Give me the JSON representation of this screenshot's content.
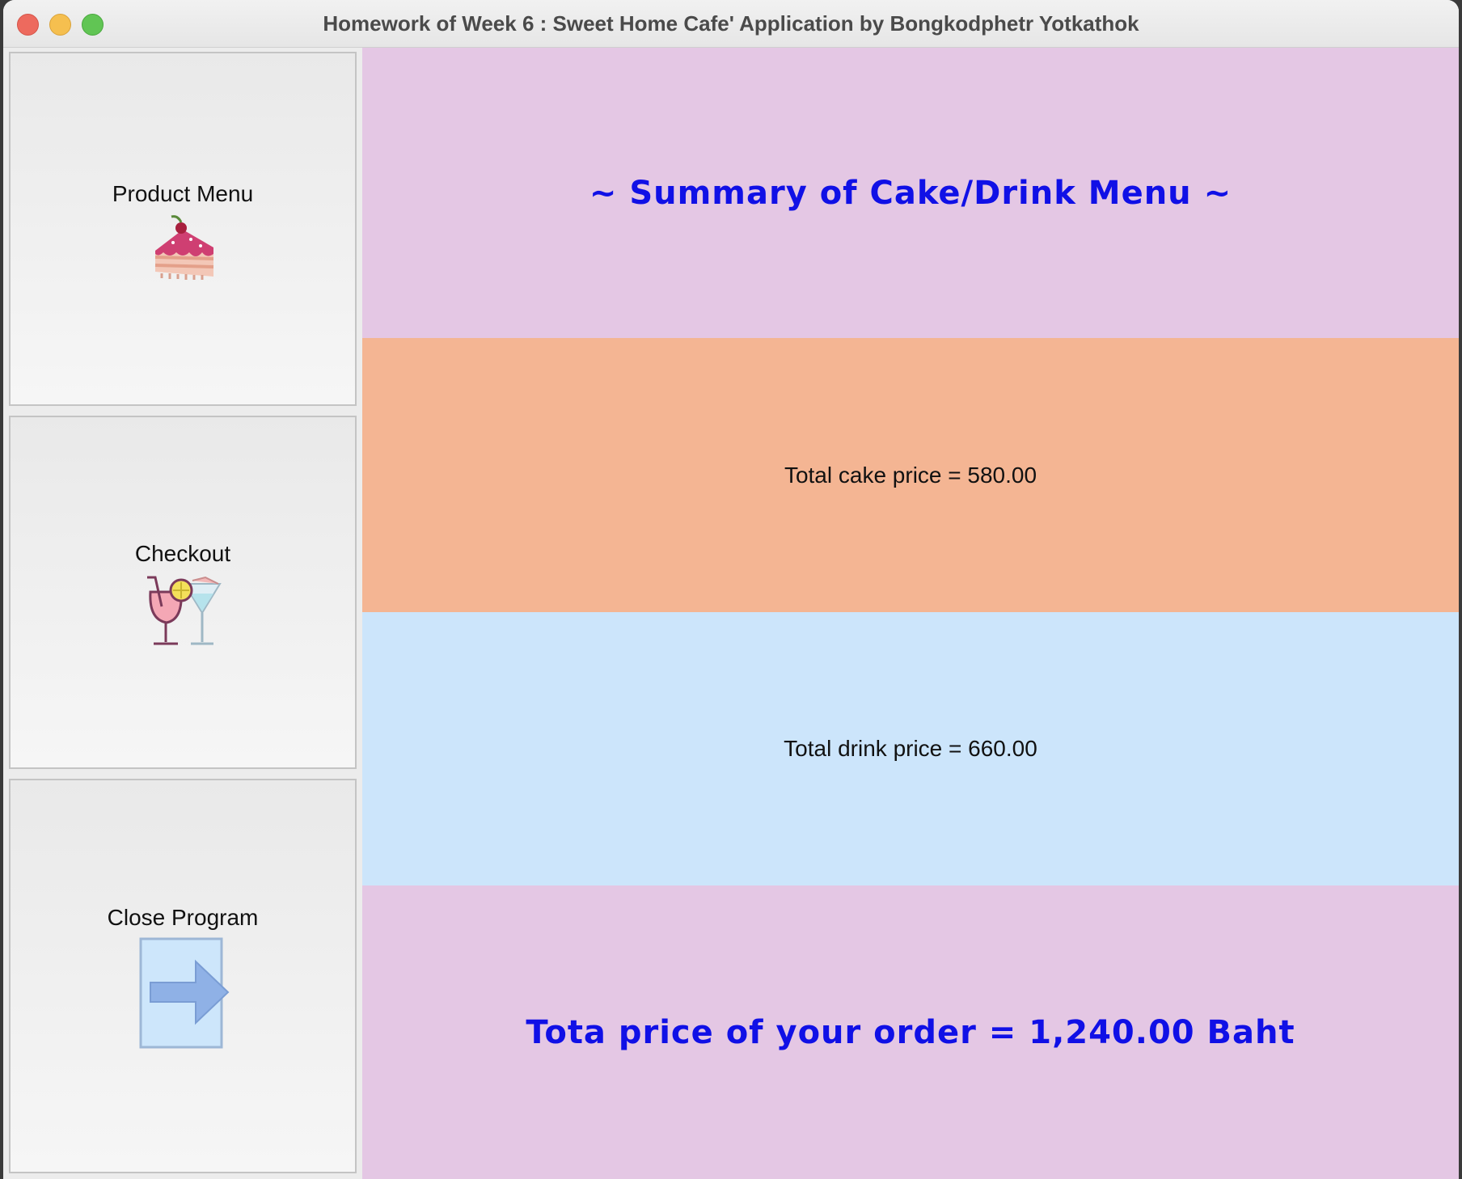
{
  "window": {
    "title": "Homework of Week 6 : Sweet Home Cafe' Application by Bongkodphetr Yotkathok"
  },
  "sidebar": {
    "buttons": [
      {
        "label": "Product Menu",
        "icon": "cake-icon"
      },
      {
        "label": "Checkout",
        "icon": "drinks-icon"
      },
      {
        "label": "Close Program",
        "icon": "exit-arrow-icon"
      }
    ]
  },
  "summary": {
    "heading": "~ Summary of Cake/Drink Menu ~",
    "cake_total": "Total cake price = 580.00",
    "drink_total": "Total drink price = 660.00",
    "order_total": "Tota price of your order = 1,240.00 Baht"
  },
  "colors": {
    "panel_purple": "#e4c7e4",
    "panel_orange": "#f4b593",
    "panel_blue": "#cce5fb",
    "heading_blue": "#1010e6"
  }
}
